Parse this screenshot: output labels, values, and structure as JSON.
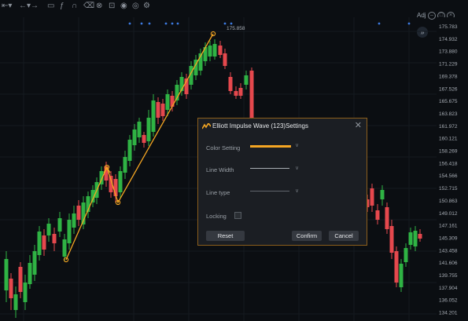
{
  "toolbar": {
    "tools": [
      "interval-arrow-icon",
      "back-forward-icon",
      "chat-icon",
      "fibonacci-icon",
      "magnet-icon",
      "eraser-icon",
      "close-circle-icon",
      "lock-icon",
      "eye-icon",
      "timer-icon",
      "settings-icon"
    ]
  },
  "header": {
    "adj_label": "Adj",
    "expand_symbol": "»"
  },
  "price_axis": {
    "labels": [
      "175.783",
      "174.932",
      "173.880",
      "171.229",
      "169.378",
      "167.526",
      "165.675",
      "163.823",
      "161.972",
      "160.121",
      "158.269",
      "156.418",
      "154.566",
      "152.715",
      "150.863",
      "149.012",
      "147.161",
      "145.309",
      "143.458",
      "141.606",
      "139.755",
      "137.904",
      "136.052",
      "134.201"
    ]
  },
  "wave": {
    "top_label": "175.858",
    "color": "#f5a623"
  },
  "colors": {
    "up": "#2fb344",
    "down": "#e5484d",
    "accent": "#f5a623",
    "background": "#0b0e12"
  },
  "dialog": {
    "title": "Elliott Impulse Wave (123)Settings",
    "close_symbol": "✕",
    "rows": {
      "color_setting": "Color Setting",
      "line_width": "Line Width",
      "line_type": "Line type",
      "locking": "Locking"
    },
    "color_value": "#f5a623",
    "buttons": {
      "reset": "Reset",
      "confirm": "Confirm",
      "cancel": "Cancel"
    }
  }
}
